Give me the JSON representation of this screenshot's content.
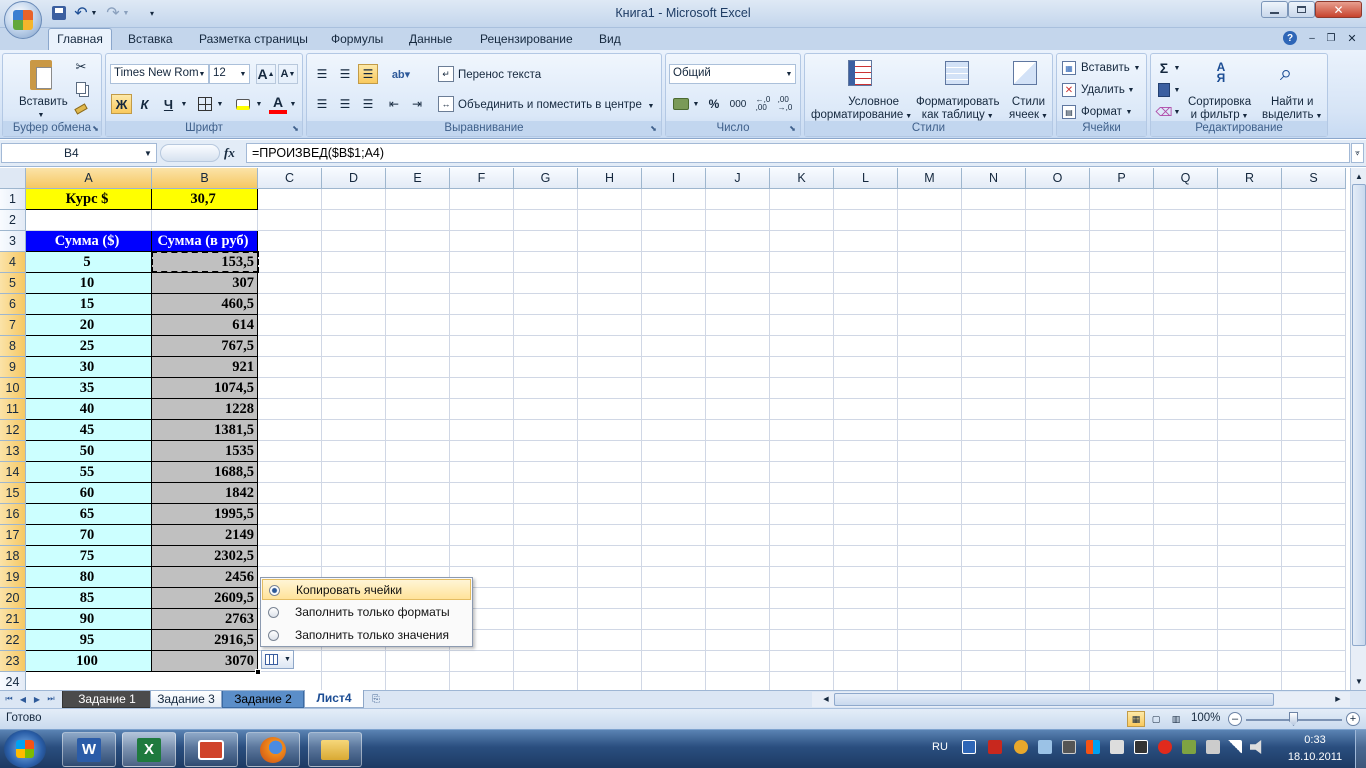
{
  "window": {
    "title": "Книга1 - Microsoft Excel"
  },
  "ribbon_tabs": [
    "Главная",
    "Вставка",
    "Разметка страницы",
    "Формулы",
    "Данные",
    "Рецензирование",
    "Вид"
  ],
  "clipboard": {
    "paste": "Вставить",
    "label": "Буфер обмена"
  },
  "font": {
    "name": "Times New Rom",
    "size": "12",
    "bold": "Ж",
    "italic": "К",
    "underline": "Ч",
    "label": "Шрифт"
  },
  "alignment": {
    "wrap": "Перенос текста",
    "merge": "Объединить и поместить в центре",
    "label": "Выравнивание"
  },
  "number": {
    "format": "Общий",
    "percent": "%",
    "thousands": "000",
    "inc": ",0\n,00",
    "dec": ",00\n,0",
    "label": "Число"
  },
  "styles": {
    "conditional": "Условное",
    "conditional2": "форматирование",
    "table": "Форматировать",
    "table2": "как таблицу",
    "cellstyles": "Стили",
    "cellstyles2": "ячеек",
    "label": "Стили"
  },
  "cells": {
    "insert": "Вставить",
    "delete": "Удалить",
    "format": "Формат",
    "label": "Ячейки"
  },
  "editing": {
    "sort": "Сортировка",
    "sort2": "и фильтр",
    "find": "Найти и",
    "find2": "выделить",
    "label": "Редактирование"
  },
  "formula_bar": {
    "namebox": "B4",
    "fx": "fx",
    "formula": "=ПРОИЗВЕД($B$1;A4)"
  },
  "columns": [
    "A",
    "B",
    "C",
    "D",
    "E",
    "F",
    "G",
    "H",
    "I",
    "J",
    "K",
    "L",
    "M",
    "N",
    "O",
    "P",
    "Q",
    "R",
    "S"
  ],
  "rows": [
    "1",
    "2",
    "3",
    "4",
    "5",
    "6",
    "7",
    "8",
    "9",
    "10",
    "11",
    "12",
    "13",
    "14",
    "15",
    "16",
    "17",
    "18",
    "19",
    "20",
    "21",
    "22",
    "23",
    "24"
  ],
  "sheet": {
    "a1": "Курс $",
    "b1": "30,7",
    "a3": "Сумма ($)",
    "b3": "Сумма (в руб)",
    "data": [
      [
        "5",
        "153,5"
      ],
      [
        "10",
        "307"
      ],
      [
        "15",
        "460,5"
      ],
      [
        "20",
        "614"
      ],
      [
        "25",
        "767,5"
      ],
      [
        "30",
        "921"
      ],
      [
        "35",
        "1074,5"
      ],
      [
        "40",
        "1228"
      ],
      [
        "45",
        "1381,5"
      ],
      [
        "50",
        "1535"
      ],
      [
        "55",
        "1688,5"
      ],
      [
        "60",
        "1842"
      ],
      [
        "65",
        "1995,5"
      ],
      [
        "70",
        "2149"
      ],
      [
        "75",
        "2302,5"
      ],
      [
        "80",
        "2456"
      ],
      [
        "85",
        "2609,5"
      ],
      [
        "90",
        "2763"
      ],
      [
        "95",
        "2916,5"
      ],
      [
        "100",
        "3070"
      ]
    ]
  },
  "autofill_menu": [
    "Копировать ячейки",
    "Заполнить только форматы",
    "Заполнить только значения"
  ],
  "sheet_tabs": [
    "Задание 1",
    "Задание 3",
    "Задание 2",
    "Лист4"
  ],
  "status": {
    "ready": "Готово",
    "zoom": "100%"
  },
  "taskbar": {
    "lang": "RU",
    "time": "0:33",
    "date": "18.10.2011"
  },
  "colors": {
    "accent": "#f4c55b",
    "header_blue": "#0000ff",
    "yellow": "#ffff00",
    "cyan": "#ccffff",
    "gray": "#c0c0c0"
  }
}
